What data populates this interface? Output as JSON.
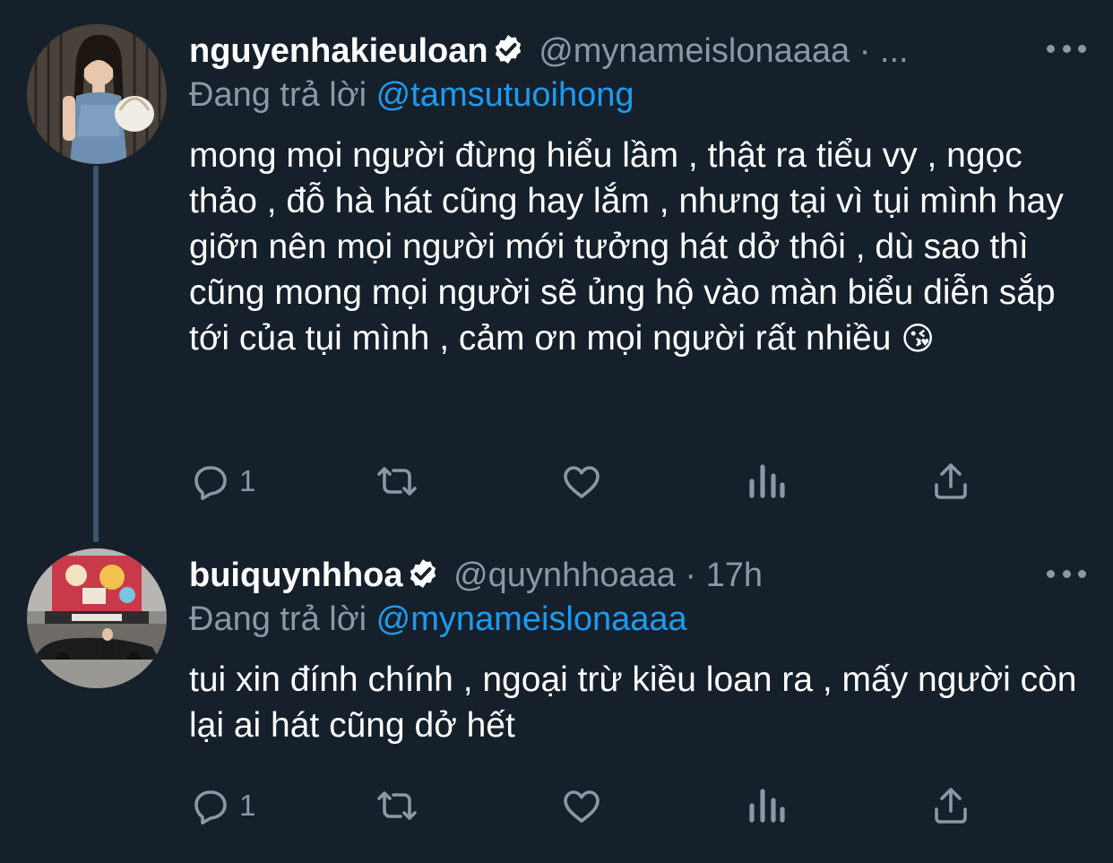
{
  "colors": {
    "background": "#15202b",
    "text": "#ffffff",
    "muted": "#8b98a5",
    "accent": "#1d9bf0",
    "thread_line": "#3d5466"
  },
  "tweets": [
    {
      "display_name": "nguyenhakieuloan",
      "handle_meta": "@mynameislonaaaa · ...",
      "verified": true,
      "replying_prefix": "Đang trả lời",
      "replying_to": "@tamsutuoihong",
      "text": "mong mọi người đừng hiểu lầm , thật ra tiểu vy , ngọc thảo , đỗ hà hát cũng hay lắm , nhưng tại vì tụi mình hay giỡn nên mọi người mới tưởng hát dở thôi , dù sao thì cũng mong mọi người sẽ ủng hộ vào màn biểu diễn sắp tới của tụi mình , cảm ơn mọi người rất nhiều",
      "emoji": "😘",
      "reply_count": "1",
      "icons": [
        "reply-icon",
        "retweet-icon",
        "like-icon",
        "analytics-icon",
        "share-icon",
        "more-icon"
      ]
    },
    {
      "display_name": "buiquynhhoa",
      "handle_meta": "@quynhhoaaa · 17h",
      "verified": true,
      "replying_prefix": "Đang trả lời",
      "replying_to": "@mynameislonaaaa",
      "text": "tui xin đính chính , ngoại trừ kiều loan ra , mấy người còn lại ai hát cũng dở hết",
      "reply_count": "1",
      "icons": [
        "reply-icon",
        "retweet-icon",
        "like-icon",
        "analytics-icon",
        "share-icon",
        "more-icon"
      ]
    }
  ]
}
